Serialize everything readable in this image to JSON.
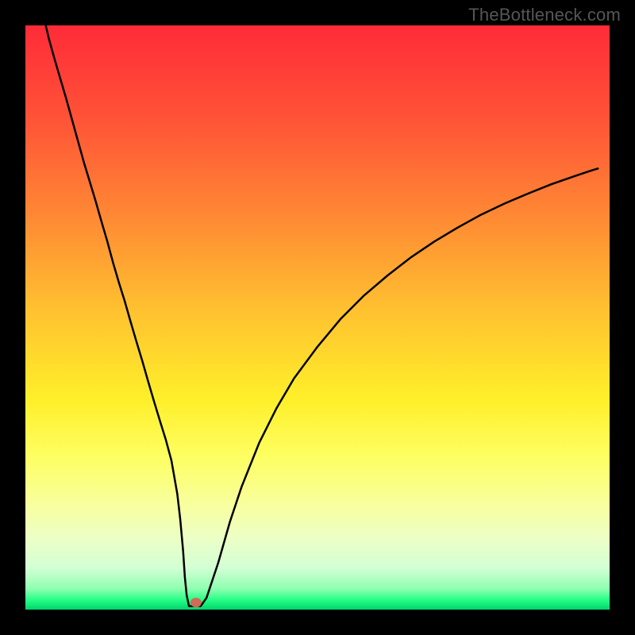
{
  "watermark": {
    "text": "TheBottleneck.com"
  },
  "chart_data": {
    "type": "line",
    "title": "",
    "xlabel": "",
    "ylabel": "",
    "xlim": [
      0,
      100
    ],
    "ylim": [
      0,
      100
    ],
    "background_gradient": {
      "top_color": "#ff2b38",
      "bottom_color": "#00d56a",
      "description": "red-to-green vertical gradient (heat to cool)"
    },
    "x": [
      3,
      4,
      5,
      6,
      7,
      8,
      9,
      10,
      11,
      12,
      13,
      14,
      15,
      16,
      17,
      18,
      19,
      20,
      21,
      22,
      23,
      24,
      25,
      26,
      26.5,
      27,
      27.3,
      27.6,
      28,
      29,
      30,
      31,
      33,
      35,
      37,
      40,
      43,
      46,
      50,
      54,
      58,
      62,
      66,
      70,
      74,
      78,
      82,
      86,
      90,
      92,
      94,
      95.5,
      97,
      98
    ],
    "values": [
      102.0,
      97.8,
      94.2,
      90.8,
      87.4,
      83.8,
      80.2,
      76.6,
      73.3,
      70.0,
      66.5,
      63.1,
      59.4,
      56.0,
      52.8,
      49.3,
      45.9,
      42.6,
      39.1,
      35.7,
      32.4,
      29.2,
      25.5,
      19.8,
      15.5,
      10.0,
      5.5,
      2.5,
      0.6,
      0.6,
      0.6,
      2.0,
      8.0,
      15.0,
      21.0,
      28.5,
      34.5,
      39.6,
      45.0,
      49.8,
      53.8,
      57.2,
      60.3,
      63.0,
      65.4,
      67.6,
      69.5,
      71.2,
      72.8,
      73.5,
      74.2,
      74.7,
      75.2,
      75.5
    ],
    "marker": {
      "x": 29.2,
      "y": 1.2,
      "color": "#d16a56"
    }
  }
}
